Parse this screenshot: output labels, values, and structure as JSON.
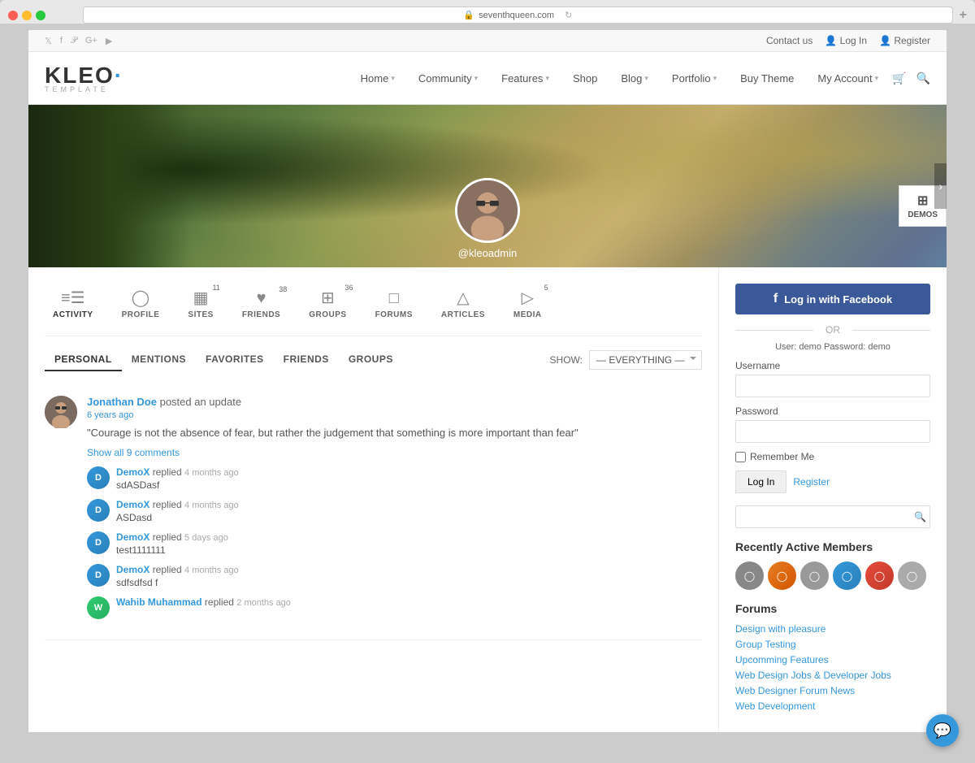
{
  "browser": {
    "url": "seventhqueen.com",
    "security_icon": "🔒"
  },
  "topbar": {
    "contact_label": "Contact us",
    "login_label": "Log In",
    "register_label": "Register"
  },
  "nav": {
    "logo_main": "KLEO",
    "logo_dot": "·",
    "logo_sub": "TEMPLATE",
    "items": [
      {
        "label": "Home",
        "has_arrow": true
      },
      {
        "label": "Community",
        "has_arrow": true
      },
      {
        "label": "Features",
        "has_arrow": true
      },
      {
        "label": "Shop",
        "has_arrow": false
      },
      {
        "label": "Blog",
        "has_arrow": true
      },
      {
        "label": "Portfolio",
        "has_arrow": true
      },
      {
        "label": "Buy Theme",
        "has_arrow": false
      },
      {
        "label": "My Account",
        "has_arrow": true
      }
    ]
  },
  "hero": {
    "username": "@kleoadmin",
    "demos_label": "DEMOS"
  },
  "profile_tabs": [
    {
      "icon": "≡",
      "label": "ACTIVITY",
      "count": "",
      "active": true
    },
    {
      "icon": "◯",
      "label": "PROFILE",
      "count": "",
      "active": false
    },
    {
      "icon": "▦",
      "label": "SITES",
      "count": "11",
      "active": false
    },
    {
      "icon": "♥",
      "label": "FRIENDS",
      "count": "38",
      "active": false
    },
    {
      "icon": "⊞",
      "label": "GROUPS",
      "count": "36",
      "active": false
    },
    {
      "icon": "□",
      "label": "FORUMS",
      "count": "",
      "active": false
    },
    {
      "icon": "△",
      "label": "ARTICLES",
      "count": "",
      "active": false
    },
    {
      "icon": "▷",
      "label": "MEDIA",
      "count": "5",
      "active": false
    }
  ],
  "activity_subtabs": [
    {
      "label": "PERSONAL",
      "active": true
    },
    {
      "label": "MENTIONS",
      "active": false
    },
    {
      "label": "FAVORITES",
      "active": false
    },
    {
      "label": "FRIENDS",
      "active": false
    },
    {
      "label": "GROUPS",
      "active": false
    }
  ],
  "show_filter": {
    "label": "SHOW:",
    "value": "— EVERYTHING —"
  },
  "activity_feed": [
    {
      "user": "Jonathan Doe",
      "action": "posted an update",
      "time": "6 years ago",
      "text": "\"Courage is not the absence of fear, but rather the judgement that something is more important than fear\"",
      "show_comments_label": "Show all 9 comments",
      "comments": [
        {
          "user": "DemoX",
          "action": "replied",
          "time": "4 months ago",
          "text": "sdASDasf"
        },
        {
          "user": "DemoX",
          "action": "replied",
          "time": "4 months ago",
          "text": "ASDasd"
        },
        {
          "user": "DemoX",
          "action": "replied",
          "time": "5 days ago",
          "text": "test1111111"
        },
        {
          "user": "DemoX",
          "action": "replied",
          "time": "4 months ago",
          "text": "sdfsdfsd f"
        },
        {
          "user": "Wahib Muhammad",
          "action": "replied",
          "time": "2 months ago",
          "text": ""
        }
      ]
    }
  ],
  "sidebar": {
    "fb_login_label": "Log in with Facebook",
    "or_label": "OR",
    "demo_hint": "User: demo Password: demo",
    "username_label": "Username",
    "password_label": "Password",
    "remember_label": "Remember Me",
    "login_btn_label": "Log In",
    "register_link_label": "Register",
    "recently_active_title": "Recently Active Members",
    "forums_title": "Forums",
    "forum_links": [
      "Design with pleasure",
      "Group Testing",
      "Upcomming Features",
      "Web Design Jobs & Developer Jobs",
      "Web Designer Forum News",
      "Web Development"
    ]
  },
  "chat": {
    "icon": "💬"
  }
}
